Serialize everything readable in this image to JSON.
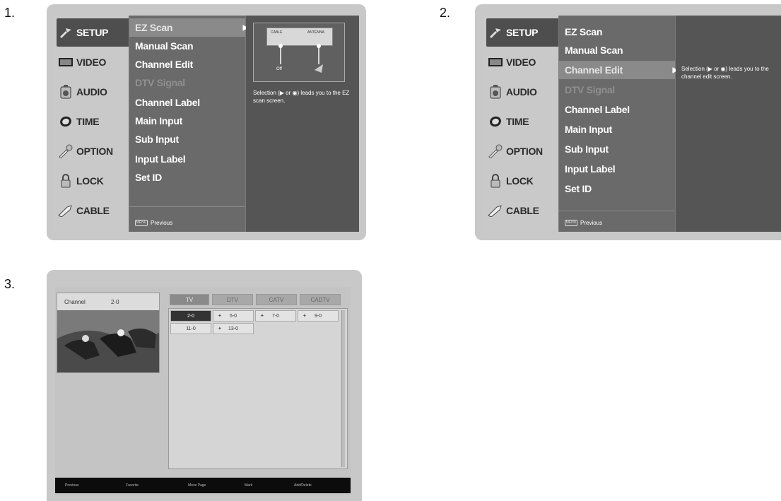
{
  "steps": [
    "1.",
    "2.",
    "3."
  ],
  "setup_menu": {
    "tabs": [
      {
        "label": "SETUP",
        "icon": "setup-icon"
      },
      {
        "label": "VIDEO",
        "icon": "video-icon"
      },
      {
        "label": "AUDIO",
        "icon": "audio-icon"
      },
      {
        "label": "TIME",
        "icon": "time-icon"
      },
      {
        "label": "OPTION",
        "icon": "option-icon"
      },
      {
        "label": "LOCK",
        "icon": "lock-icon"
      },
      {
        "label": "CABLE",
        "icon": "cable-icon"
      }
    ],
    "items": [
      "EZ Scan",
      "Manual Scan",
      "Channel Edit",
      "DTV Signal",
      "Channel Label",
      "Main Input",
      "Sub Input",
      "Input Label",
      "Set ID"
    ],
    "previous_key": "MENU",
    "previous_label": "Previous"
  },
  "screen1": {
    "selected_item": "EZ Scan",
    "diagram": {
      "label_left": "CABLE",
      "label_right": "ANTENNA",
      "button": "Off"
    },
    "help": "Selection (▶ or ◉) leads you to the EZ scan screen."
  },
  "screen2": {
    "selected_item": "Channel Edit",
    "help": "Selection (▶ or ◉) leads you to the channel edit screen."
  },
  "screen3": {
    "pip_source": "Channel",
    "pip_channel": "2-0",
    "tabs": [
      "TV",
      "DTV",
      "CATV",
      "CADTV"
    ],
    "channels": [
      {
        "num": "2-0",
        "fav": false,
        "selected": true
      },
      {
        "num": "5-0",
        "fav": true,
        "selected": false
      },
      {
        "num": "7-0",
        "fav": true,
        "selected": false
      },
      {
        "num": "9-0",
        "fav": true,
        "selected": false
      },
      {
        "num": "11-0",
        "fav": false,
        "selected": false
      },
      {
        "num": "13-0",
        "fav": true,
        "selected": false
      }
    ],
    "footer": [
      "Previous",
      "Favorite",
      "Move Page",
      "Mark",
      "Add/Delete"
    ]
  },
  "colors": {
    "frame": "#c8c8c8",
    "menu_bg": "#555555",
    "submenu_bg": "#6a6a6a",
    "footer_bg": "#0c0c0c"
  }
}
